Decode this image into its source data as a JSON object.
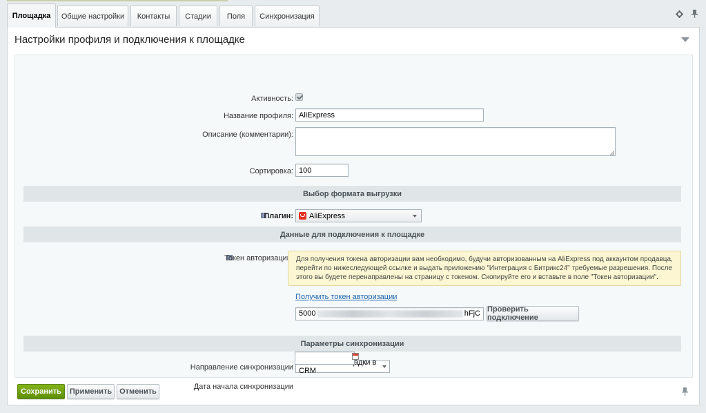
{
  "tabs": [
    "Площадка",
    "Общие настройки",
    "Контакты",
    "Стадии",
    "Поля",
    "Синхронизация"
  ],
  "active_tab": "Площадка",
  "panel": {
    "title": "Настройки профиля и подключения к площадке"
  },
  "form": {
    "active_label": "Активность:",
    "active_checked": true,
    "name_label": "Название профиля:",
    "name_value": "AliExpress",
    "description_label": "Описание (комментарии):",
    "description_value": "",
    "sort_label": "Сортировка:",
    "sort_value": "100"
  },
  "sections": {
    "format": "Выбор формата выгрузки",
    "connection": "Данные для подключения к площадке",
    "sync": "Параметры синхронизации"
  },
  "plugin": {
    "label": "Плагин:",
    "value": "AliExpress",
    "icon": "aliexpress-icon"
  },
  "token": {
    "label": "Токен авторизации:",
    "notice": "Для получения токена авторизации вам необходимо, будучи авторизованным на AliExpress под аккаунтом продавца, перейти по нижеследующей ссылке и выдать приложению \"Интеграция с Битрикс24\" требуемые разрешения. После этого вы будете перенаправлены на страницу с токеном. Скопируйте его и вставьте в поле \"Токен авторизации\".",
    "link": "Получить токен авторизации",
    "value_start": "5000",
    "value_end": "hFjC",
    "check_button": "Проверить подключение"
  },
  "sync": {
    "direction_label": "Направление синхронизации",
    "direction_value": "Только из площадки в CRM",
    "start_date_label": "Дата начала синхронизации",
    "start_date_value": ""
  },
  "buttons": {
    "save": "Сохранить",
    "apply": "Применить",
    "cancel": "Отменить"
  },
  "colors": {
    "accent_green": "#6a9b0f",
    "section_bg": "#e0e6e8",
    "notice_bg": "#fcf6d3",
    "link": "#2067b0"
  }
}
